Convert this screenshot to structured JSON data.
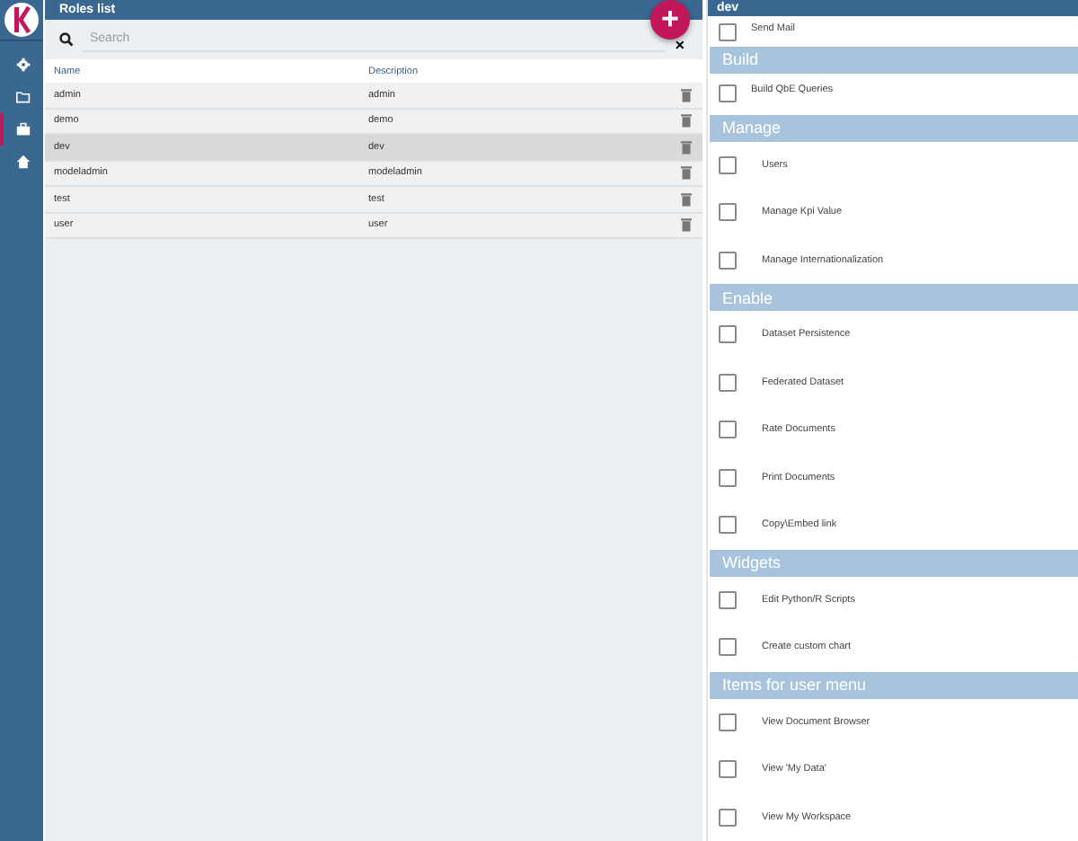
{
  "sidebar": {
    "items": [
      {
        "kind": "gear",
        "selected": false
      },
      {
        "kind": "folder",
        "selected": false
      },
      {
        "kind": "briefcase",
        "selected": true
      },
      {
        "kind": "home",
        "selected": false
      }
    ]
  },
  "roles_list": {
    "title": "Roles list",
    "search": {
      "placeholder": "Search"
    },
    "clear": "×",
    "add": "+",
    "columns": [
      "Name",
      "Description"
    ],
    "rows": [
      {
        "name": "admin",
        "description": "admin",
        "selected": false
      },
      {
        "name": "demo",
        "description": "demo",
        "selected": false
      },
      {
        "name": "dev",
        "description": "dev",
        "selected": true
      },
      {
        "name": "modeladmin",
        "description": "modeladmin",
        "selected": false
      },
      {
        "name": "test",
        "description": "test",
        "selected": false
      },
      {
        "name": "user",
        "description": "user",
        "selected": false
      }
    ]
  },
  "detail": {
    "title": "dev",
    "sections": [
      {
        "items": [
          {
            "label": "Send Mail",
            "checked": false
          }
        ]
      },
      {
        "title": "Build",
        "items": [
          {
            "label": "Build QbE Queries",
            "checked": false
          }
        ]
      },
      {
        "title": "Manage",
        "items": [
          {
            "label": "Users",
            "checked": false
          },
          {
            "label": "Manage Kpi Value",
            "checked": false
          },
          {
            "label": "Manage Internationalization",
            "checked": false
          }
        ]
      },
      {
        "title": "Enable",
        "items": [
          {
            "label": "Dataset Persistence",
            "checked": false
          },
          {
            "label": "Federated Dataset",
            "checked": false
          },
          {
            "label": "Rate Documents",
            "checked": false
          },
          {
            "label": "Print Documents",
            "checked": false
          },
          {
            "label": "Copy\\Embed link",
            "checked": false
          }
        ]
      },
      {
        "title": "Widgets",
        "items": [
          {
            "label": "Edit Python/R Scripts",
            "checked": false
          },
          {
            "label": "Create custom chart",
            "checked": false
          }
        ]
      },
      {
        "title": "Items for user menu",
        "items": [
          {
            "label": "View Document Browser",
            "checked": false
          },
          {
            "label": "View 'My Data'",
            "checked": false
          },
          {
            "label": "View My Workspace",
            "checked": false
          }
        ]
      }
    ]
  }
}
